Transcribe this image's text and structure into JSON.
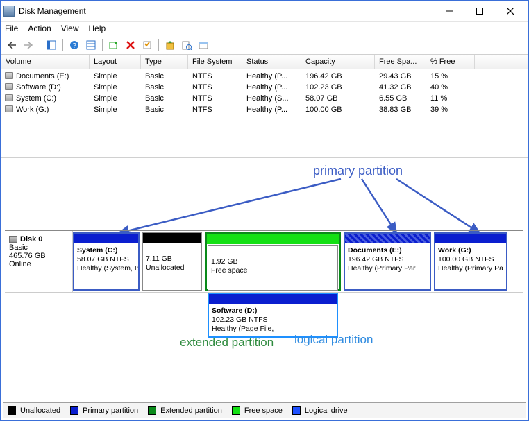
{
  "window": {
    "title": "Disk Management"
  },
  "menu": [
    "File",
    "Action",
    "View",
    "Help"
  ],
  "columns": [
    "Volume",
    "Layout",
    "Type",
    "File System",
    "Status",
    "Capacity",
    "Free Spa...",
    "% Free"
  ],
  "volumes": [
    {
      "name": "Documents (E:)",
      "layout": "Simple",
      "type": "Basic",
      "fs": "NTFS",
      "status": "Healthy (P...",
      "capacity": "196.42 GB",
      "free": "29.43 GB",
      "pct": "15 %"
    },
    {
      "name": "Software (D:)",
      "layout": "Simple",
      "type": "Basic",
      "fs": "NTFS",
      "status": "Healthy (P...",
      "capacity": "102.23 GB",
      "free": "41.32 GB",
      "pct": "40 %"
    },
    {
      "name": "System (C:)",
      "layout": "Simple",
      "type": "Basic",
      "fs": "NTFS",
      "status": "Healthy (S...",
      "capacity": "58.07 GB",
      "free": "6.55 GB",
      "pct": "11 %"
    },
    {
      "name": "Work (G:)",
      "layout": "Simple",
      "type": "Basic",
      "fs": "NTFS",
      "status": "Healthy (P...",
      "capacity": "100.00 GB",
      "free": "38.83 GB",
      "pct": "39 %"
    }
  ],
  "disk": {
    "name": "Disk 0",
    "type": "Basic",
    "size": "465.76 GB",
    "status": "Online"
  },
  "partitions": {
    "system": {
      "title": "System  (C:)",
      "line2": "58.07 GB NTFS",
      "line3": "Healthy (System, B"
    },
    "unalloc": {
      "line2": "7.11 GB",
      "line3": "Unallocated"
    },
    "free": {
      "line2": "1.92 GB",
      "line3": "Free space"
    },
    "software": {
      "title": "Software  (D:)",
      "line2": "102.23 GB NTFS",
      "line3": "Healthy (Page File,"
    },
    "documents": {
      "title": "Documents  (E:)",
      "line2": "196.42 GB NTFS",
      "line3": "Healthy (Primary Par"
    },
    "work": {
      "title": "Work  (G:)",
      "line2": "100.00 GB NTFS",
      "line3": "Healthy (Primary Pa"
    }
  },
  "annotations": {
    "primary": "primary partition",
    "extended": "extended partition",
    "logical": "logical partition"
  },
  "legend": {
    "unallocated": "Unallocated",
    "primary": "Primary partition",
    "extended": "Extended partition",
    "free": "Free space",
    "logical": "Logical drive"
  },
  "colors": {
    "primary": "#0a1ecf",
    "extended": "#0a8a1a",
    "free": "#14e014",
    "logical": "#1e90ff",
    "unalloc": "#000000"
  }
}
